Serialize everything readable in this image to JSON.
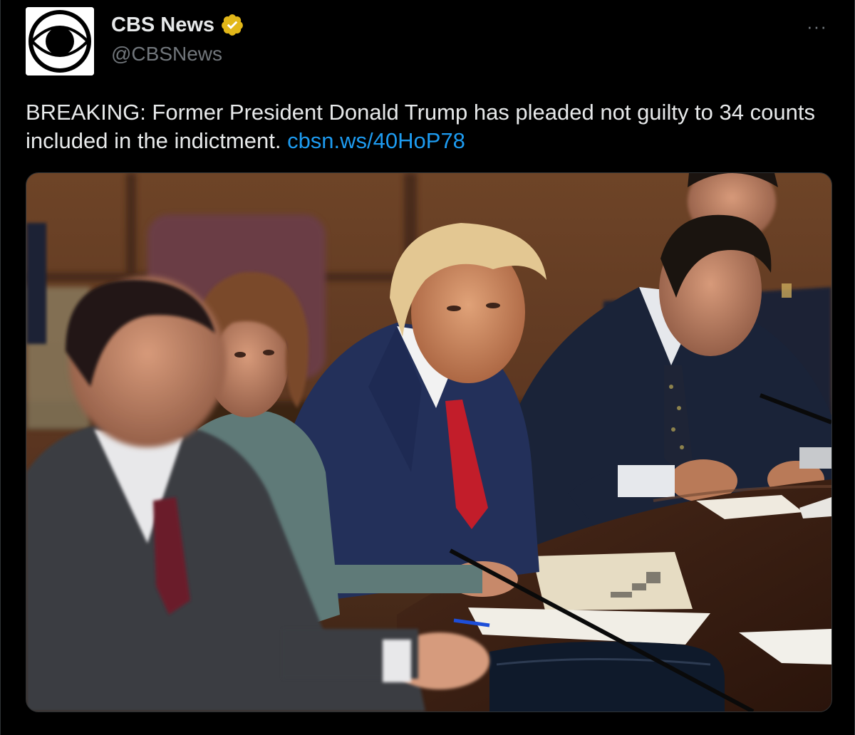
{
  "author": {
    "display_name": "CBS News",
    "handle": "@CBSNews",
    "avatar_icon": "cbs-eye-logo",
    "verified_icon": "verified-badge-gold"
  },
  "tweet": {
    "text": "BREAKING: Former President Donald Trump has pleaded not guilty to 34 counts included in the indictment. ",
    "link_text": "cbsn.ws/40HoP78"
  },
  "more_label": "···",
  "colors": {
    "background": "#000000",
    "link": "#1d9bf0",
    "handle": "#71767b",
    "verified": "#e2b719"
  }
}
